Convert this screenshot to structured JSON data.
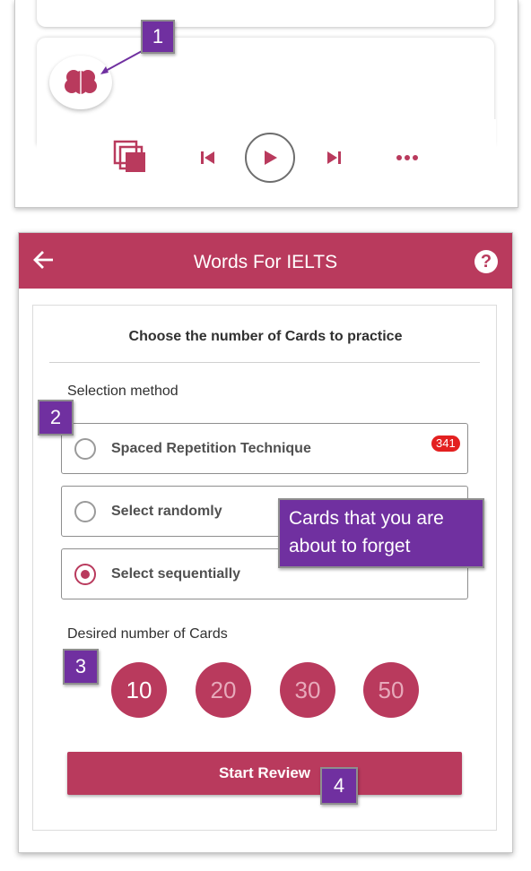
{
  "player": {
    "controls": [
      "flashcards-icon",
      "previous-icon",
      "play-icon",
      "next-icon",
      "more-icon"
    ]
  },
  "app": {
    "title": "Words For IELTS",
    "help_symbol": "?"
  },
  "dialog": {
    "title": "Choose the number of Cards to practice",
    "selection_label": "Selection method",
    "options": [
      {
        "label": "Spaced Repetition Technique",
        "selected": false,
        "badge": "341"
      },
      {
        "label": "Select randomly",
        "selected": false
      },
      {
        "label": "Select sequentially",
        "selected": true
      }
    ],
    "count_label": "Desired number of Cards",
    "counts": [
      "10",
      "20",
      "30",
      "50"
    ],
    "selected_count": "10",
    "start_label": "Start Review"
  },
  "annotations": {
    "n1": "1",
    "n2": "2",
    "n3": "3",
    "n4": "4",
    "callout": "Cards that you are about to forget"
  },
  "colors": {
    "primary": "#b93a5d",
    "annotation": "#7030a0",
    "badge": "#e32020"
  }
}
